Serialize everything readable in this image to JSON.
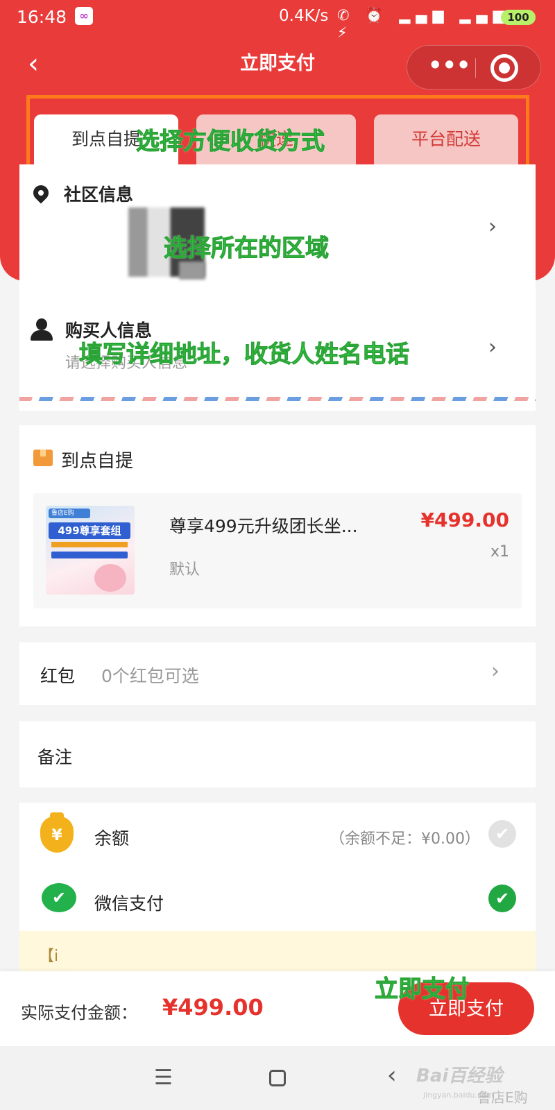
{
  "status_bar": {
    "time": "16:48",
    "app_badge": "∞",
    "speed": "0.4K/s",
    "icons": "✆ ⏰ ▂▄▆ ▂▄▆ ◠ ⚡",
    "battery": "100"
  },
  "nav": {
    "back_icon": "‹",
    "title": "立即支付",
    "more_icon": "•••"
  },
  "tabs": [
    "到点自提",
    "快递",
    "平台配送"
  ],
  "community": {
    "title": "社区信息"
  },
  "buyer": {
    "title": "购买人信息",
    "placeholder": "请选择购买人信息"
  },
  "order": {
    "pickup_label": "到点自提",
    "product": {
      "name": "尊享499元升级团长坐...",
      "variant": "默认",
      "price": "¥499.00",
      "qty": "x1",
      "thumb_brand": "鲁店E购",
      "thumb_banner": "499尊享套组"
    }
  },
  "red_packet": {
    "label": "红包",
    "value": "0个红包可选"
  },
  "remarks": {
    "label": "备注"
  },
  "payment": {
    "balance_label": "余额",
    "balance_note": "（余额不足：¥0.00）",
    "wechat_label": "微信支付",
    "coin_glyph": "¥",
    "check_glyph": "✔"
  },
  "notice": {
    "text": "【i"
  },
  "footer": {
    "total_label": "实际支付金额：",
    "total_amount": "¥499.00",
    "pay_button": "立即支付"
  },
  "system_nav": {
    "menu_icon": "☰",
    "back_icon": "‹"
  },
  "watermark": {
    "baidu": "Bai百经验",
    "sub": "jingyan.baidu.com",
    "account": "鲁店E购"
  },
  "annotations": {
    "choose_delivery": "选择方便收货方式",
    "choose_area": "选择所在的区域",
    "fill_address": "填写详细地址，收货人姓名电话",
    "pay_now": "立即支付"
  },
  "colors": {
    "brand_red": "#e93b39",
    "price_red": "#e6322c",
    "annotation_green": "#3dd64a",
    "highlight_orange": "#ff7a1c",
    "wechat_green": "#22a843"
  }
}
